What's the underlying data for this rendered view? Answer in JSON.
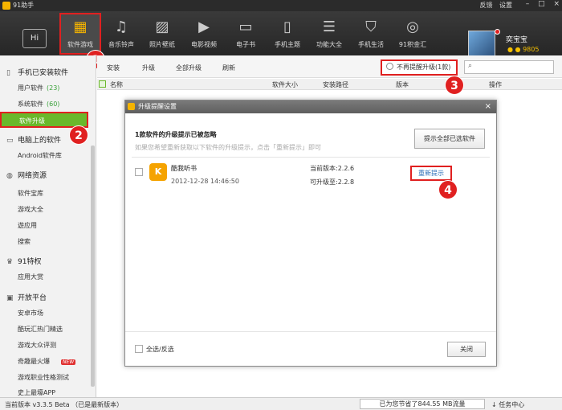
{
  "titlebar": {
    "title": "91助手",
    "links": [
      "反馈",
      "设置"
    ],
    "win_min": "–",
    "win_max": "□",
    "win_close": "×"
  },
  "nav": {
    "hi_label": "Hi",
    "items": [
      {
        "label": "软件游戏",
        "icon": "apps-grid-icon"
      },
      {
        "label": "音乐铃声",
        "icon": "music-note-icon"
      },
      {
        "label": "照片壁纸",
        "icon": "photo-icon"
      },
      {
        "label": "电影视频",
        "icon": "film-icon"
      },
      {
        "label": "电子书",
        "icon": "book-icon"
      },
      {
        "label": "手机主题",
        "icon": "phone-theme-icon"
      },
      {
        "label": "功能大全",
        "icon": "toolbox-icon"
      },
      {
        "label": "手机生活",
        "icon": "shopping-bag-icon"
      },
      {
        "label": "91积金汇",
        "icon": "coin-icon"
      }
    ]
  },
  "user": {
    "name": "奕宝宝",
    "coins": "9805"
  },
  "sidebar": {
    "sec1": "手机已安装软件",
    "user_soft": "用户软件",
    "user_soft_count": "(23)",
    "sys_soft": "系统软件",
    "sys_soft_count": "(60)",
    "upgrade": "软件升级",
    "sec2": "电脑上的软件",
    "android_lib": "Android软件库",
    "sec3": "网络资源",
    "net_items": [
      "软件宝库",
      "游戏大全",
      "遊应用",
      "搜索"
    ],
    "sec4": "91特权",
    "priv_items": [
      "应用大赏"
    ],
    "sec5": "开放平台",
    "open_items": [
      "安卓市场",
      "酷玩汇热门精选",
      "游戏大众评测",
      "奇趣最火爆",
      "游戏职业性格测试",
      "史上最壕APP"
    ],
    "new_badge": "NEW"
  },
  "toolbar": {
    "buttons": [
      "安装",
      "升级",
      "全部升级",
      "刷新"
    ],
    "no_remind": "不再提醒升级(1款)",
    "search_placeholder": ""
  },
  "table": {
    "cols": [
      "名称",
      "软件大小",
      "安装路径",
      "版本",
      "操作"
    ]
  },
  "dialog": {
    "title": "升级提醒设置",
    "heading": "1款软件的升级提示已被忽略",
    "subtext": "如果您希望重新获取以下软件的升级提示，点击「重新提示」即可",
    "show_all_btn": "提示全部已选软件",
    "app": {
      "icon_text": "K",
      "name": "酷我听书",
      "date": "2012-12-28 14:46:50",
      "current_version": "当前版本:2.2.6",
      "upgradable_version": "可升级至:2.2.8"
    },
    "remind_btn": "重新提示",
    "select_all": "全选/反选",
    "close_btn": "关闭"
  },
  "callouts": [
    "1",
    "2",
    "3",
    "4"
  ],
  "statusbar": {
    "version": "当前版本 v3.3.5 Beta （已是最新版本）",
    "saved": "已为您节省了844.55 MB流量",
    "tasks": "任务中心"
  },
  "colors": {
    "accent_green": "#6ab82b",
    "callout_red": "#e02020",
    "toolbar_dark": "#2b2b2b",
    "coin_gold": "#f5c000"
  }
}
